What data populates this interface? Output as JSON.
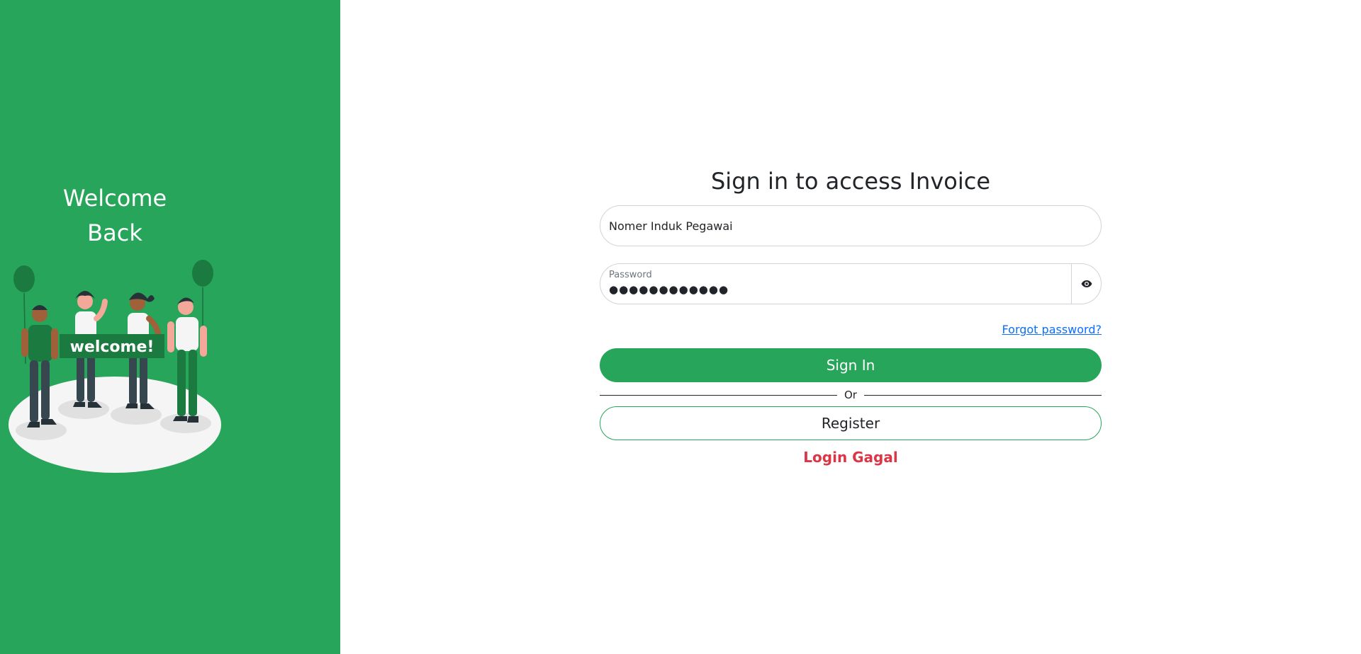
{
  "left_panel": {
    "welcome_line1": "Welcome",
    "welcome_line2": "Back",
    "illustration": {
      "banner_text": "welcome!",
      "alt": "people-holding-welcome-banner"
    }
  },
  "form": {
    "title": "Sign in to access Invoice",
    "nip_placeholder": "Nomer Induk Pegawai",
    "nip_value": "",
    "password_label": "Password",
    "password_value": "●●●●●●●●●●●●",
    "password_toggle_icon": "eye-icon",
    "forgot_label": "Forgot password?",
    "signin_label": "Sign In",
    "or_label": "Or",
    "register_label": "Register",
    "error_message": "Login Gagal"
  },
  "colors": {
    "primary": "#27a55a",
    "error": "#dc3545",
    "link": "#0d6efd"
  }
}
